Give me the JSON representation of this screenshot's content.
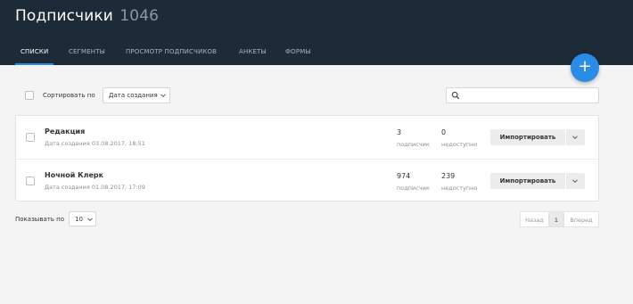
{
  "header": {
    "title": "Подписчики",
    "count": "1046"
  },
  "tabs": [
    {
      "label": "Списки",
      "active": true
    },
    {
      "label": "Сегменты"
    },
    {
      "label": "Просмотр подписчиков"
    },
    {
      "label": "Анкеты"
    },
    {
      "label": "Формы"
    }
  ],
  "fab": {
    "icon": "plus-icon",
    "label": "+"
  },
  "toolbar": {
    "sort_label": "Сортировать по",
    "sort_value": "Дата создания",
    "search_placeholder": ""
  },
  "lists": [
    {
      "name": "Редакция",
      "date": "Дата создания 03.08.2017, 18:51",
      "subscribers": "3",
      "subscribers_label": "подписчик",
      "unavailable": "0",
      "unavailable_label": "недоступно",
      "import_label": "Импортировать"
    },
    {
      "name": "Ночной Клерк",
      "date": "Дата создания 01.08.2017, 17:09",
      "subscribers": "974",
      "subscribers_label": "подписчик",
      "unavailable": "239",
      "unavailable_label": "недоступно",
      "import_label": "Импортировать"
    }
  ],
  "footer": {
    "show_label": "Показывать по",
    "per_page": "10",
    "pagination": {
      "prev": "Назад",
      "current": "1",
      "next": "Вперед"
    }
  },
  "colors": {
    "header_bg": "#1d2a38",
    "accent": "#2b8ce6",
    "page_bg": "#f4f4f4"
  }
}
